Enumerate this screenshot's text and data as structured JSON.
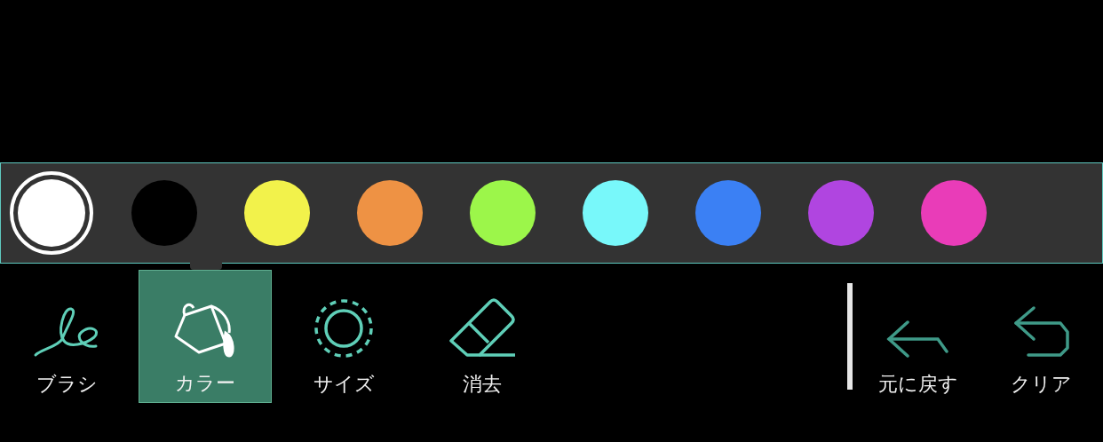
{
  "palette": [
    {
      "color": "#ffffff",
      "selected": true
    },
    {
      "color": "#000000",
      "selected": false
    },
    {
      "color": "#f2f24b",
      "selected": false
    },
    {
      "color": "#ee9244",
      "selected": false
    },
    {
      "color": "#9cf64a",
      "selected": false
    },
    {
      "color": "#78f8fa",
      "selected": false
    },
    {
      "color": "#3b80f4",
      "selected": false
    },
    {
      "color": "#b045e0",
      "selected": false
    },
    {
      "color": "#e93cb8",
      "selected": false
    }
  ],
  "tools": [
    {
      "kind": "brush",
      "label": "ブラシ",
      "selected": false
    },
    {
      "kind": "color",
      "label": "カラー",
      "selected": true
    },
    {
      "kind": "size",
      "label": "サイズ",
      "selected": false
    },
    {
      "kind": "eraser",
      "label": "消去",
      "selected": false
    }
  ],
  "actions": [
    {
      "kind": "undo",
      "label": "元に戻す"
    },
    {
      "kind": "clear",
      "label": "クリア"
    }
  ]
}
